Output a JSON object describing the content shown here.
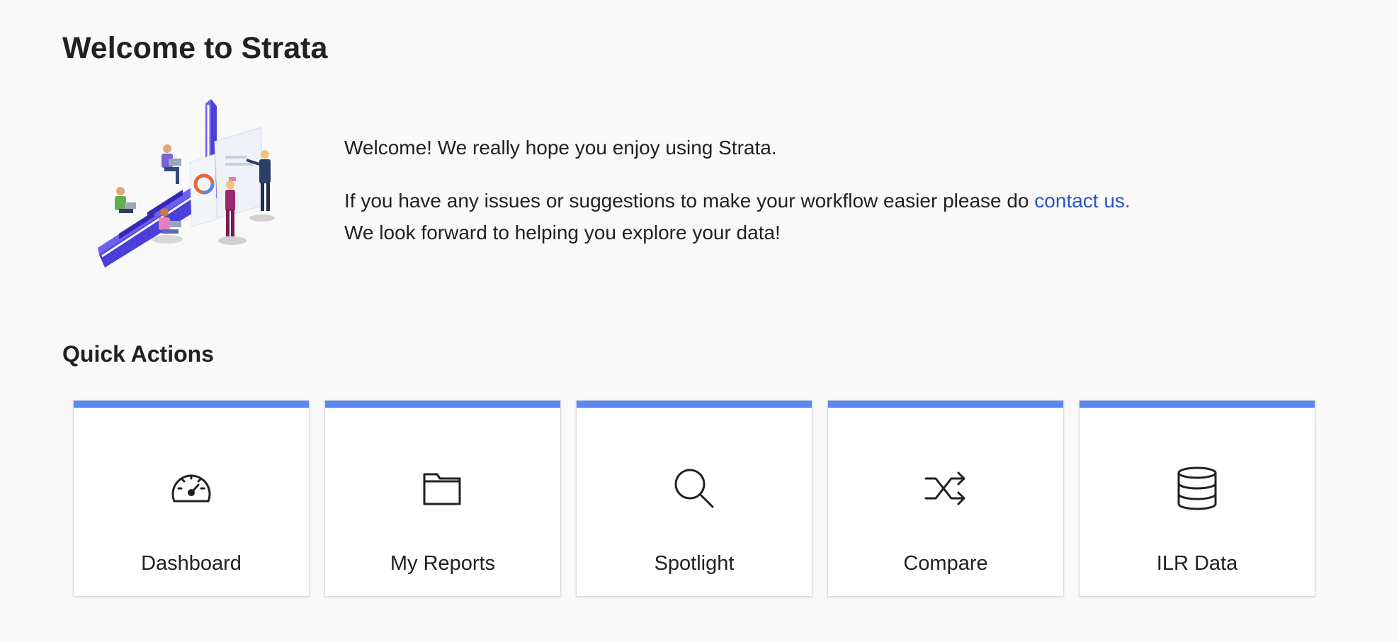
{
  "header": {
    "title": "Welcome to Strata"
  },
  "welcome": {
    "line1": "Welcome! We really hope you enjoy using Strata.",
    "line2_prefix": "If you have any issues or suggestions to make your workflow easier please do ",
    "contact_link": "contact us.",
    "line3": "We look forward to helping you explore your data!"
  },
  "quick_actions": {
    "title": "Quick Actions",
    "accent_color": "#5b87f2",
    "cards": [
      {
        "label": "Dashboard",
        "icon": "speedometer-icon"
      },
      {
        "label": "My Reports",
        "icon": "folder-icon"
      },
      {
        "label": "Spotlight",
        "icon": "search-icon"
      },
      {
        "label": "Compare",
        "icon": "shuffle-icon"
      },
      {
        "label": "ILR Data",
        "icon": "database-icon"
      }
    ]
  }
}
